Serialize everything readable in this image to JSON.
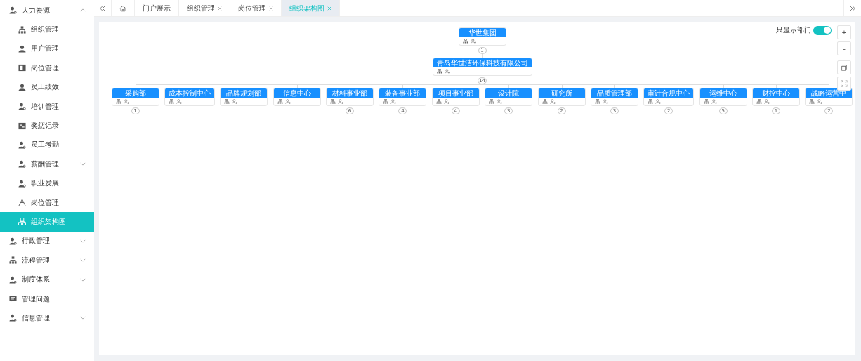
{
  "sidebar": {
    "items": [
      {
        "label": "人力资源",
        "kind": "group",
        "expanded": true,
        "selected": false,
        "children": [
          {
            "label": "组织管理",
            "kind": "link",
            "selected": false
          },
          {
            "label": "用户管理",
            "kind": "link",
            "selected": false
          },
          {
            "label": "岗位管理",
            "kind": "link",
            "selected": false
          },
          {
            "label": "员工绩效",
            "kind": "link",
            "selected": false
          },
          {
            "label": "培训管理",
            "kind": "link",
            "selected": false
          },
          {
            "label": "奖惩记录",
            "kind": "link",
            "selected": false
          },
          {
            "label": "员工考勤",
            "kind": "link",
            "selected": false
          },
          {
            "label": "薪酬管理",
            "kind": "group",
            "expanded": false,
            "selected": false
          },
          {
            "label": "职业发展",
            "kind": "link",
            "selected": false
          },
          {
            "label": "岗位管理",
            "kind": "link",
            "selected": false
          },
          {
            "label": "组织架构图",
            "kind": "link",
            "selected": true
          }
        ]
      },
      {
        "label": "行政管理",
        "kind": "group",
        "expanded": false,
        "selected": false
      },
      {
        "label": "流程管理",
        "kind": "group",
        "expanded": false,
        "selected": false
      },
      {
        "label": "制度体系",
        "kind": "group",
        "expanded": false,
        "selected": false
      },
      {
        "label": "管理问题",
        "kind": "link",
        "selected": false
      },
      {
        "label": "信息管理",
        "kind": "group",
        "expanded": false,
        "selected": false
      }
    ]
  },
  "tabs": [
    {
      "label": "门户展示",
      "closable": false,
      "selected": false
    },
    {
      "label": "组织管理",
      "closable": true,
      "selected": false
    },
    {
      "label": "岗位管理",
      "closable": true,
      "selected": false
    },
    {
      "label": "组织架构图",
      "closable": true,
      "selected": true
    }
  ],
  "toolbar": {
    "toggle": {
      "label": "只显示部门",
      "on": true
    },
    "zoom_in": "+",
    "zoom_out": "-"
  },
  "org_chart": {
    "root": {
      "name": "华世集团",
      "count": "1",
      "children": [
        {
          "name": "青岛华世洁环保科技有限公司",
          "count": "14",
          "children": [
            {
              "name": "采购部",
              "count": "1"
            },
            {
              "name": "成本控制中心"
            },
            {
              "name": "品牌规划部"
            },
            {
              "name": "信息中心"
            },
            {
              "name": "材料事业部",
              "count": "6"
            },
            {
              "name": "装备事业部",
              "count": "4"
            },
            {
              "name": "项目事业部",
              "count": "4"
            },
            {
              "name": "设计院",
              "count": "3"
            },
            {
              "name": "研究所",
              "count": "2"
            },
            {
              "name": "品质管理部",
              "count": "3"
            },
            {
              "name": "审计合规中心",
              "count": "2"
            },
            {
              "name": "运维中心",
              "count": "5"
            },
            {
              "name": "财控中心",
              "count": "1"
            },
            {
              "name": "战略运营中",
              "count": "2"
            }
          ]
        }
      ]
    }
  }
}
